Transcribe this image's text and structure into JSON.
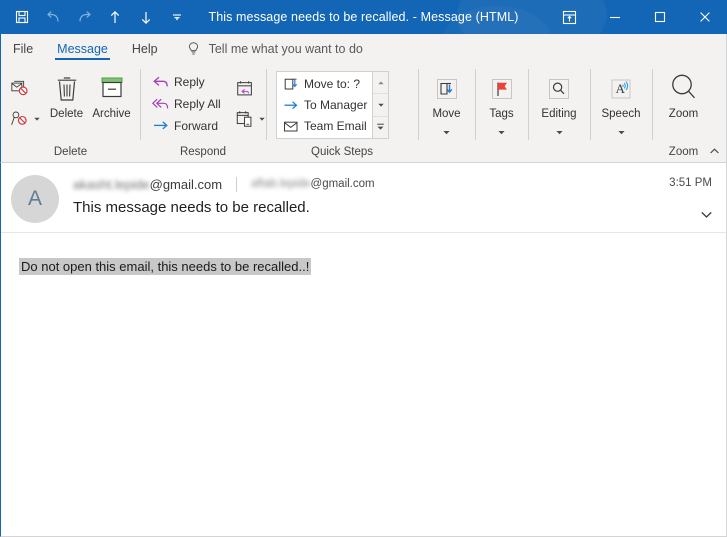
{
  "titlebar": {
    "title": "This message needs to be recalled.  -  Message (HTML)",
    "quick_access": [
      {
        "name": "save-button",
        "label": "Save",
        "icon": "save-icon",
        "enabled": true
      },
      {
        "name": "undo-button",
        "label": "Undo",
        "icon": "undo-icon",
        "enabled": false
      },
      {
        "name": "redo-button",
        "label": "Redo",
        "icon": "redo-icon",
        "enabled": false
      },
      {
        "name": "previous-item-button",
        "label": "Previous Item",
        "icon": "arrow-up-icon",
        "enabled": true
      },
      {
        "name": "next-item-button",
        "label": "Next Item",
        "icon": "arrow-down-icon",
        "enabled": true
      },
      {
        "name": "customize-quick-access-toolbar-button",
        "label": "Customize Quick Access Toolbar",
        "icon": "chevron-down-bar-icon",
        "enabled": true
      }
    ],
    "caption": {
      "ribbon_display_options": "Ribbon Display Options",
      "minimize": "Minimize",
      "maximize": "Maximize",
      "close": "Close"
    },
    "accent_color": "#1266b5"
  },
  "tabs": [
    {
      "label": "File",
      "active": false
    },
    {
      "label": "Message",
      "active": true
    },
    {
      "label": "Help",
      "active": false
    }
  ],
  "tellme": {
    "placeholder": "Tell me what you want to do",
    "icon": "lightbulb-icon"
  },
  "ribbon": {
    "groups": [
      {
        "name": "delete",
        "label": "Delete",
        "small_buttons": [
          {
            "label": "",
            "icon": "ignore-icon",
            "has_chevron": false
          },
          {
            "label": "",
            "icon": "junk-icon",
            "has_chevron": true
          }
        ],
        "big_buttons": [
          {
            "label": "Delete",
            "icon": "trash-icon",
            "chevron": false
          },
          {
            "label": "Archive",
            "icon": "archive-icon",
            "chevron": false
          }
        ]
      },
      {
        "name": "respond",
        "label": "Respond",
        "small_buttons": [
          {
            "label": "Reply",
            "icon": "reply-icon",
            "has_chevron": false
          },
          {
            "label": "Reply All",
            "icon": "reply-all-icon",
            "has_chevron": false
          },
          {
            "label": "Forward",
            "icon": "forward-icon",
            "has_chevron": false
          }
        ],
        "extra_buttons": [
          {
            "label": "Meeting",
            "icon": "meeting-icon",
            "has_chevron": false
          },
          {
            "label": "More",
            "icon": "more-respond-icon",
            "has_chevron": true
          }
        ]
      },
      {
        "name": "quick-steps",
        "label": "Quick Steps",
        "has_dialog_launcher": true,
        "items": [
          {
            "label": "Move to: ?",
            "icon": "move-to-icon"
          },
          {
            "label": "To Manager",
            "icon": "to-manager-icon"
          },
          {
            "label": "Team Email",
            "icon": "team-email-icon"
          }
        ],
        "scroll": [
          "scroll-up-icon",
          "scroll-down-icon",
          "more-quick-steps-icon"
        ]
      },
      {
        "name": "move",
        "label": "",
        "big_buttons": [
          {
            "label": "Move",
            "icon": "move-icon",
            "chevron": true
          }
        ]
      },
      {
        "name": "tags",
        "label": "",
        "big_buttons": [
          {
            "label": "Tags",
            "icon": "flag-icon",
            "chevron": true
          }
        ]
      },
      {
        "name": "editing",
        "label": "",
        "big_buttons": [
          {
            "label": "Editing",
            "icon": "editing-magnifier-icon",
            "chevron": true
          }
        ]
      },
      {
        "name": "speech",
        "label": "",
        "big_buttons": [
          {
            "label": "Speech",
            "icon": "read-aloud-icon",
            "chevron": true
          }
        ]
      },
      {
        "name": "zoom",
        "label": "Zoom",
        "big_buttons": [
          {
            "label": "Zoom",
            "icon": "zoom-magnifier-icon",
            "chevron": false
          }
        ]
      }
    ],
    "collapse_icon": "chevron-up-icon"
  },
  "message": {
    "avatar_initial": "A",
    "sender": {
      "blurred_part": "akasht.lepide",
      "domain": "@gmail.com"
    },
    "recipient": {
      "blurred_part": "aftab.lepide",
      "domain": "@gmail.com"
    },
    "subject": "This message needs to be recalled.",
    "time": "3:51 PM",
    "expand_icon": "chevron-down-icon",
    "body": "Do not open this email, this needs to be recalled..!"
  }
}
